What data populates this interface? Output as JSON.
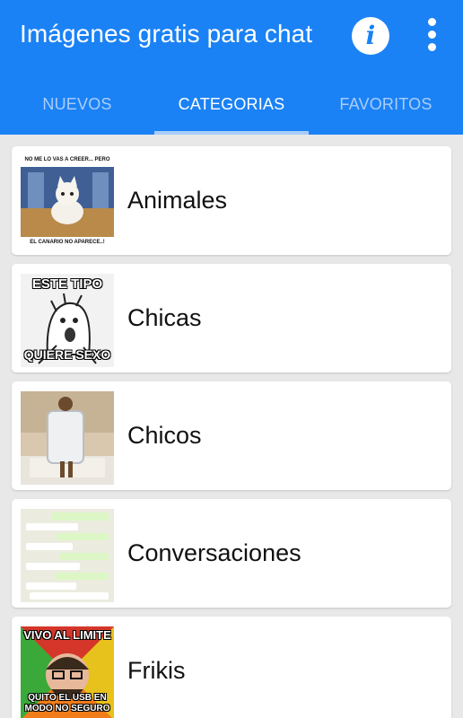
{
  "app": {
    "title": "Imágenes gratis para chat",
    "accent": "#1b82f5"
  },
  "tabs": [
    {
      "label": "NUEVOS",
      "active": false
    },
    {
      "label": "CATEGORIAS",
      "active": true
    },
    {
      "label": "FAVORITOS",
      "active": false
    }
  ],
  "categories": [
    {
      "label": "Animales",
      "thumb_top": "NO ME LO VAS A CREER... PERO",
      "thumb_bottom": "EL CANARIO NO APARECE..!"
    },
    {
      "label": "Chicas",
      "thumb_top": "ESTE TIPO",
      "thumb_bottom": "QUIERE SEXO"
    },
    {
      "label": "Chicos"
    },
    {
      "label": "Conversaciones"
    },
    {
      "label": "Frikis",
      "thumb_top": "VIVO AL LIMITE",
      "thumb_bottom": "QUITO EL USB EN MODO NO SEGURO"
    }
  ]
}
